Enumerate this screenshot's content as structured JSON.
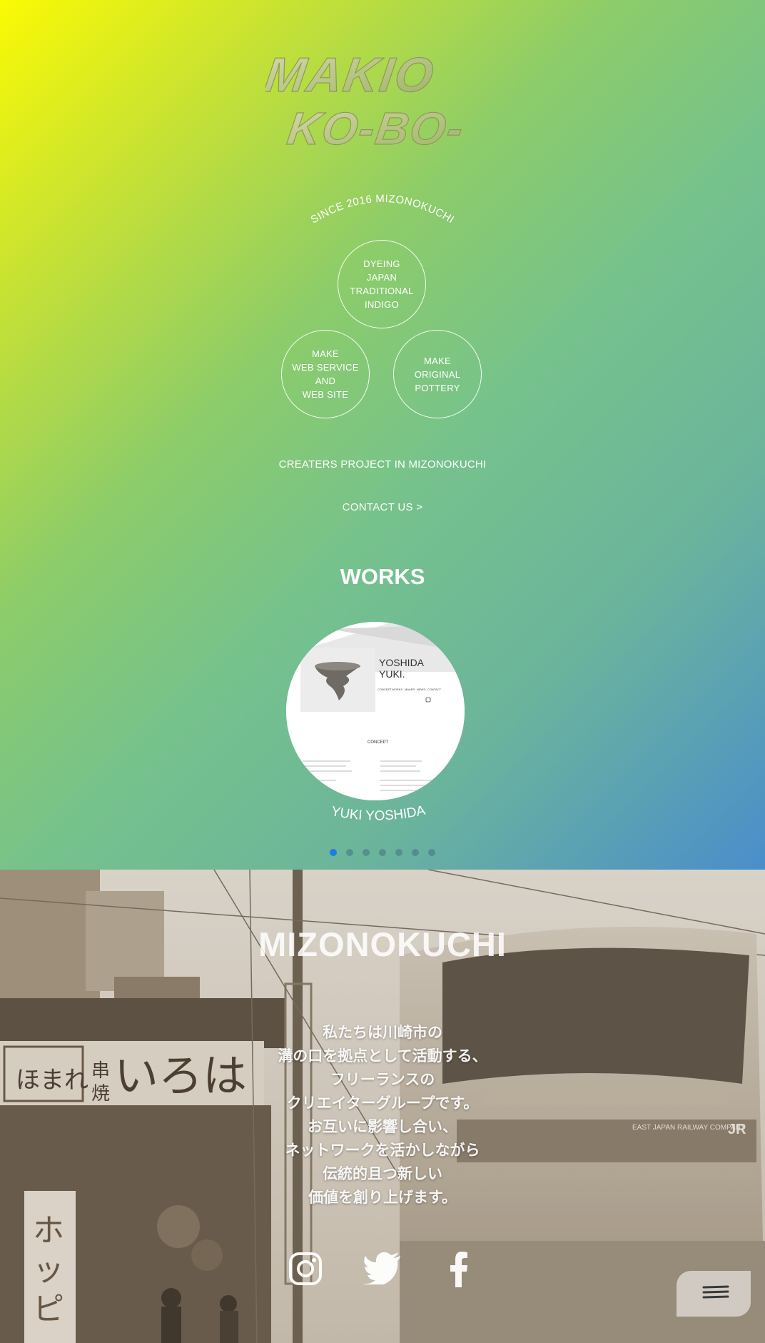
{
  "brand": {
    "logo_line1": "MAKIO",
    "logo_line2": "KO-BO-",
    "since": "SINCE 2016 MIZONOKUCHI"
  },
  "services": [
    {
      "label": "DYEING\nJAPAN\nTRADITIONAL\nINDIGO"
    },
    {
      "label": "MAKE\nWEB SERVICE\nAND\nWEB SITE"
    },
    {
      "label": "MAKE\nORIGINAL\nPOTTERY"
    }
  ],
  "tagline": "CREATERS PROJECT IN MIZONOKUCHI",
  "contact": "CONTACT US  >",
  "works": {
    "title": "WORKS",
    "items": [
      {
        "label": "YUKI YOSHIDA",
        "preview": {
          "name_line1": "YOSHIDA",
          "name_line2": "YUKI.",
          "nav": [
            "CONCEPT",
            "WORKS",
            "MAKER",
            "NEWS",
            "CONTACT"
          ],
          "section": "CONCEPT"
        }
      }
    ],
    "active_slide": 1,
    "total_slides": 7
  },
  "mizonokuchi": {
    "title": "MIZONOKUCHI",
    "lines": [
      "私たちは川崎市の",
      "溝の口を拠点として活動する、",
      "フリーランスの",
      "クリエイターグループです。",
      "お互いに影響し合い、",
      "ネットワークを活かしながら",
      "伝統的且つ新しい",
      "価値を創り上げます。"
    ]
  },
  "social": [
    "instagram-icon",
    "twitter-icon",
    "facebook-icon"
  ],
  "colors": {
    "gradient_start": "#fbfa04",
    "gradient_mid": "#76c28c",
    "gradient_end": "#4a8ecb",
    "active_dot": "#1e7de0"
  }
}
